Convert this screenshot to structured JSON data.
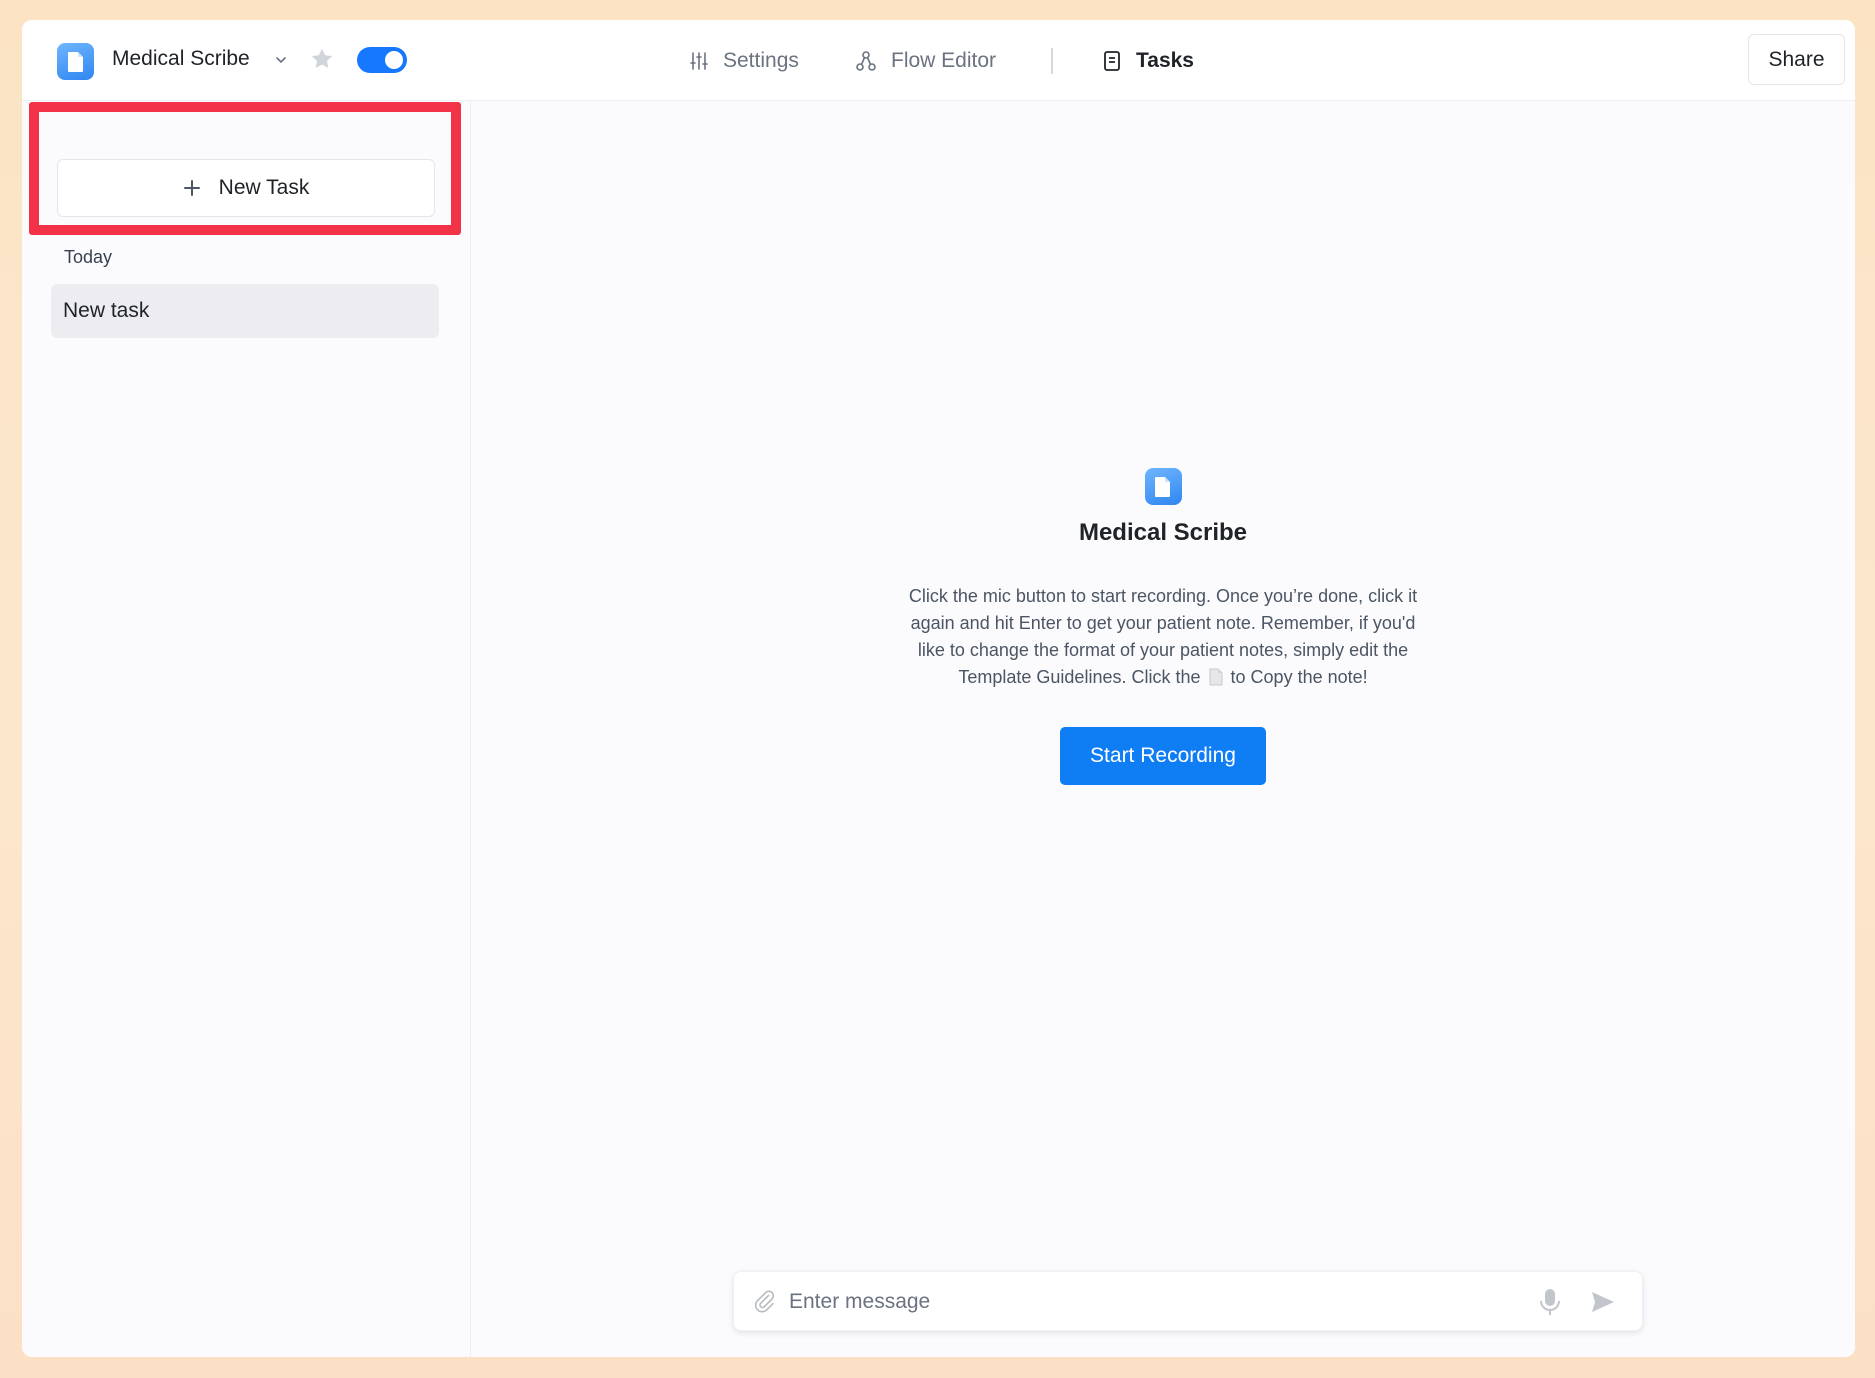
{
  "header": {
    "app_name": "Medical Scribe",
    "toggle_on": true,
    "nav": {
      "settings": "Settings",
      "flow_editor": "Flow Editor",
      "tasks": "Tasks"
    },
    "share_label": "Share"
  },
  "sidebar": {
    "new_task_label": "New Task",
    "group_label": "Today",
    "tasks": [
      {
        "label": "New task",
        "selected": true
      }
    ]
  },
  "main": {
    "title": "Medical Scribe",
    "description_part1": "Click the mic button to start recording. Once you’re done, click it again and hit Enter to get your patient note. Remember, if you'd like to change the format of your patient notes, simply edit the Template Guidelines. Click the",
    "description_part2": "to Copy the note!",
    "start_label": "Start Recording",
    "composer_placeholder": "Enter message",
    "help_label": "?"
  },
  "colors": {
    "accent": "#0f7ef4",
    "highlight": "#f23347",
    "page_background": "#fce7cd"
  },
  "icons": [
    "document-icon",
    "chevron-down-icon",
    "star-icon",
    "sliders-icon",
    "flow-icon",
    "tasks-icon",
    "plus-icon",
    "paperclip-icon",
    "mic-icon",
    "send-icon"
  ]
}
